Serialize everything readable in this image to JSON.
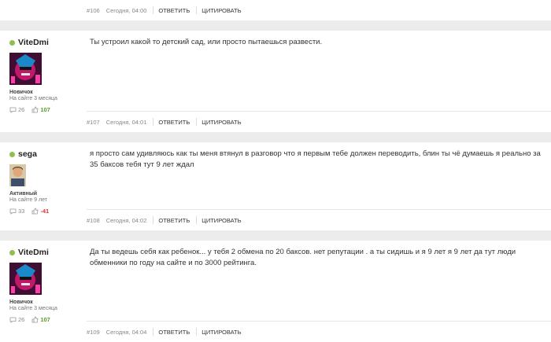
{
  "posts": [
    {
      "id": "#106",
      "time": "Сегодня, 04:00",
      "reply": "ОТВЕТИТЬ",
      "quote": "ЦИТИРОВАТЬ"
    },
    {
      "id": "#107",
      "time": "Сегодня, 04:01",
      "reply": "ОТВЕТИТЬ",
      "quote": "ЦИТИРОВАТЬ",
      "username": "ViteDmi",
      "rank": "Новичок",
      "since": "На сайте 3 месяца",
      "messages": "26",
      "rep": "107",
      "text": "Ты устроил какой то детский сад, или просто пытаешься развести."
    },
    {
      "id": "#108",
      "time": "Сегодня, 04:02",
      "reply": "ОТВЕТИТЬ",
      "quote": "ЦИТИРОВАТЬ",
      "username": "sega",
      "rank": "Активный",
      "since": "На сайте 9 лет",
      "messages": "33",
      "rep": "-41",
      "text": "я просто сам удивляюсь как ты меня втянул в разговор что я первым тебе должен переводить, блин ты чё думаешь я реально за 35 баксов тебя тут 9 лет ждал"
    },
    {
      "id": "#109",
      "time": "Сегодня, 04:04",
      "reply": "ОТВЕТИТЬ",
      "quote": "ЦИТИРОВАТЬ",
      "username": "ViteDmi",
      "rank": "Новичок",
      "since": "На сайте 3 месяца",
      "messages": "26",
      "rep": "107",
      "text": "Да ты ведешь себя как ребенок... у тебя 2 обмена по 20 баксов. нет репутации . а ты сидишь и я 9 лет я 9 лет да тут люди обменники по году на сайте и по 3000 рейтинга."
    }
  ],
  "colors": {
    "online": "#8ec04f",
    "rep_positive": "#5b9a2c",
    "rep_negative": "#dd3333"
  },
  "icons": {
    "messages": "speech-bubble-icon",
    "rep": "thumbs-up-icon"
  }
}
